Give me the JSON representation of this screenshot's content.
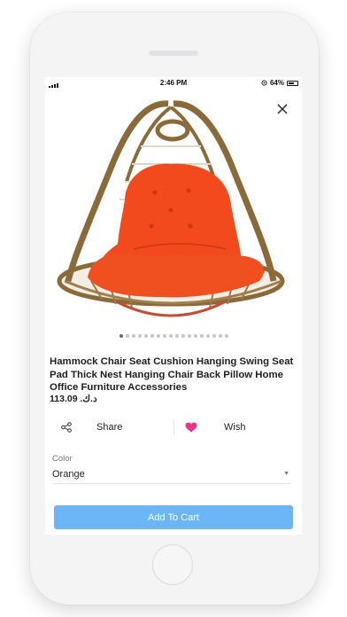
{
  "status_bar": {
    "time": "2:46 PM",
    "battery": "64%"
  },
  "product": {
    "title": "Hammock Chair Seat Cushion Hanging Swing Seat Pad Thick Nest Hanging Chair Back Pillow Home Office Furniture Accessories",
    "price": "113.09 .د.ك",
    "image_slides": 18,
    "active_slide": 0
  },
  "actions": {
    "share_label": "Share",
    "wish_label": "Wish"
  },
  "color": {
    "label": "Color",
    "selected": "Orange"
  },
  "cart": {
    "button_label": "Add To Cart"
  },
  "colors": {
    "accent": "#6cb6f7",
    "wish_heart": "#e8358f",
    "cushion": "#f24a1c",
    "rattan": "#8b6a3a"
  }
}
